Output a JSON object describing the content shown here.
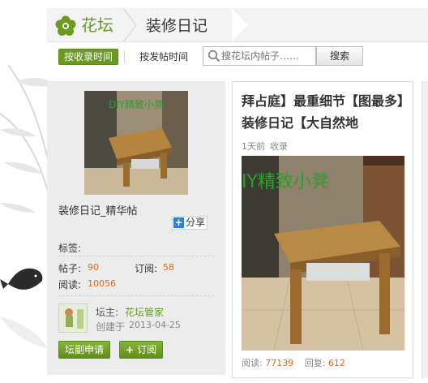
{
  "header": {
    "brand": "花坛",
    "breadcrumb": "装修日记"
  },
  "toolbar": {
    "sort_active": "按收录时间",
    "sort_other": "按发帖时间",
    "search_placeholder": "搜花坛内帖子……",
    "search_button": "搜索"
  },
  "panel": {
    "cover_caption": "DIY精致小凳",
    "title": "装修日记_精华帖",
    "share": "分享",
    "tags_label": "标签:",
    "posts_label": "帖子:",
    "posts_value": "90",
    "subs_label": "订阅:",
    "subs_value": "58",
    "reads_label": "阅读:",
    "reads_value": "10056",
    "owner_label": "坛主:",
    "owner_name": "花坛管家",
    "created_label": "创建于",
    "created_date": "2013-04-25",
    "apply_button": "坛副申请",
    "subscribe_button": "订阅",
    "subscribe_plus": "+"
  },
  "card": {
    "title": "拜占庭】最重细节【图最多】装修日记【大自然地",
    "time": "1天前",
    "tag": "收录",
    "image_caption": "IY精致小凳",
    "reads_label": "阅读:",
    "reads_value": "77139",
    "replies_label": "回复:",
    "replies_value": "612"
  },
  "colors": {
    "accent": "#6a9a1f",
    "number": "#e06a1b",
    "caption_green": "#2ca02c"
  },
  "icons": [
    "flower-logo-icon",
    "search-icon",
    "share-plus-icon",
    "plus-icon"
  ]
}
